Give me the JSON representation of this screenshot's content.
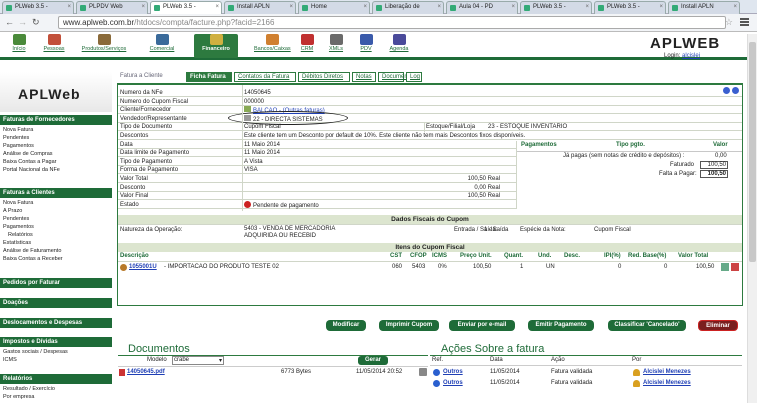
{
  "browser": {
    "tabs": [
      {
        "label": "PLWeb 3.5 -"
      },
      {
        "label": "PLPDV Web"
      },
      {
        "label": "PLWeb 3.5 -"
      },
      {
        "label": "Install APLN"
      },
      {
        "label": "Home"
      },
      {
        "label": "Liberação de"
      },
      {
        "label": "Aula 04 - PD"
      },
      {
        "label": "PLWeb 3.5 -"
      },
      {
        "label": "PLWeb 3.5 -"
      },
      {
        "label": "Install APLN"
      }
    ],
    "url_host": "www.aplweb.com.br",
    "url_path": "/htdocs/compta/facture.php?facid=2166"
  },
  "toolbar": {
    "items": [
      {
        "label": "Início",
        "color": "#4a8a3a"
      },
      {
        "label": "Pessoas",
        "color": "#c2503a"
      },
      {
        "label": "Produtos/Serviços",
        "color": "#8a6a3a"
      },
      {
        "label": "Comercial",
        "color": "#3a6a9a"
      },
      {
        "label": "Financeiro",
        "color": "#d0b040"
      },
      {
        "label": "Bancos/Caixas",
        "color": "#d08030"
      },
      {
        "label": "CRM",
        "color": "#c03030"
      },
      {
        "label": "XMLs",
        "color": "#6a6a6a"
      },
      {
        "label": "PDV",
        "color": "#3a5aaa"
      },
      {
        "label": "Agenda",
        "color": "#4a4a9a"
      }
    ],
    "brand": "APLWEB",
    "login_label": "Login:",
    "login_user": "alcislei"
  },
  "sidebar": {
    "brand": "APLWeb",
    "sections": [
      {
        "title": "Faturas de Fornecedores",
        "items": [
          "Nova Fatura",
          "Pendentes",
          "Pagamentos",
          "Análise de Compras",
          "Baixa Contas a Pagar",
          "Portal Nacional da NFe"
        ]
      },
      {
        "title": "Faturas a Clientes",
        "items": [
          "Nova Fatura",
          "A Prazo",
          "Pendentes",
          "Pagamentos",
          "Relatórios",
          "Estatísticas",
          "Análise de Faturamento",
          "Baixa Contas a Receber"
        ]
      },
      {
        "title": "Pedidos por Faturar",
        "items": []
      },
      {
        "title": "Doações",
        "items": []
      },
      {
        "title": "Deslocamentos e Despesas",
        "items": []
      },
      {
        "title": "Impostos e Dívidas",
        "items": [
          "Gastos sociais / Despesas",
          "ICMS"
        ]
      },
      {
        "title": "Relatórios",
        "items": [
          "Resultado / Exercício",
          "Por empresa"
        ]
      }
    ]
  },
  "tabs": {
    "prev": "Fatura a Cliente",
    "items": [
      "Ficha Fatura",
      "Contatos da Fatura",
      "Débitos Diretos",
      "Notas",
      "Documentos",
      "Log"
    ]
  },
  "invoice": {
    "rows": [
      {
        "k": "Numero da NFe",
        "v": "14050645"
      },
      {
        "k": "Numero do Cupom Fiscal",
        "v": "000000"
      },
      {
        "k": "Cliente/Fornecedor",
        "v": "BALCAO - (Outras faturas)"
      },
      {
        "k": "Vendedor/Representante",
        "v": "22 - DIRECTA SISTEMAS"
      },
      {
        "k": "Tipo de Documento",
        "v": "Cupom Fiscal"
      },
      {
        "k": "Descontos",
        "v": "Este cliente tem um Desconto por default de 10%. Este cliente não tem mais Descontos fixos disponíveis."
      },
      {
        "k": "Data",
        "v": "11 Maio 2014"
      },
      {
        "k": "Data limite de Pagamento",
        "v": "11 Maio 2014"
      },
      {
        "k": "Tipo de Pagamento",
        "v": "A Vista"
      },
      {
        "k": "Forma de Pagamento",
        "v": "VISA"
      },
      {
        "k": "Valor Total",
        "v": "100,50 Real"
      },
      {
        "k": "Desconto",
        "v": "0,00 Real"
      },
      {
        "k": "Valor Final",
        "v": "100,50 Real"
      },
      {
        "k": "Estado",
        "v": "Pendente de pagamento"
      }
    ],
    "estoque_label": "Estoque/Filial/Loja",
    "estoque_value": "23 - ESTOQUE INVENTARIO",
    "payments": {
      "h_pag": "Pagamentos",
      "h_tipo": "Tipo pgto.",
      "h_valor": "Valor",
      "ja_pagas": "Já pagas (sem notas de crédito e depósitos) :",
      "ja_val": "0,00",
      "faturado": "Faturado",
      "faturado_val": "100,50",
      "falta": "Falta a Pagar:",
      "falta_val": "100,50"
    },
    "fiscal_title": "Dados Fiscais do Cupom",
    "natureza_label": "Natureza da Operação:",
    "natureza_value": "5403 - VENDA DE MERCADORIA ADQUIRIDA OU RECEBID",
    "entrada_label": "Entrada / Saída:",
    "entrada_value": "1 - Saída",
    "especie_label": "Espécie da Nota:",
    "especie_value": "Cupom Fiscal",
    "items_title": "Itens do Cupom Fiscal",
    "item_headers": [
      "Descrição",
      "CST",
      "CFOP",
      "ICMS",
      "Preço Unit.",
      "Quant.",
      "Und.",
      "Desc.",
      "IPI(%)",
      "Red. Base(%)",
      "Valor Total"
    ],
    "item_row": {
      "code": "1055001U",
      "desc": " - IMPORTACAO DO PRODUTO TESTE 02",
      "cst": "060",
      "cfop": "5403",
      "icms": "0%",
      "preco": "100,50",
      "quant": "1",
      "und": "UN",
      "desc2": "",
      "ipi": "0",
      "red": "0",
      "total": "100,50"
    }
  },
  "actions": [
    "Modificar",
    "Imprimir Cupom",
    "Enviar por e-mail",
    "Emitir Pagamento",
    "Classificar 'Cancelado'",
    "Eliminar"
  ],
  "docs": {
    "title": "Documentos",
    "modelo_label": "Modelo",
    "modelo_value": "crabe",
    "gerar": "Gerar",
    "file": "14050645.pdf",
    "size": "6773 Bytes",
    "date": "11/05/2014 20:52"
  },
  "acoes": {
    "title": "Ações Sobre a fatura",
    "headers": [
      "Ref.",
      "Data",
      "Ação",
      "Por"
    ],
    "rows": [
      {
        "ref": "Outros",
        "data": "11/05/2014",
        "acao": "Fatura validada",
        "por": "Alcislei Menezes"
      },
      {
        "ref": "Outros",
        "data": "11/05/2014",
        "acao": "Fatura validada",
        "por": "Alcislei Menezes"
      }
    ]
  }
}
